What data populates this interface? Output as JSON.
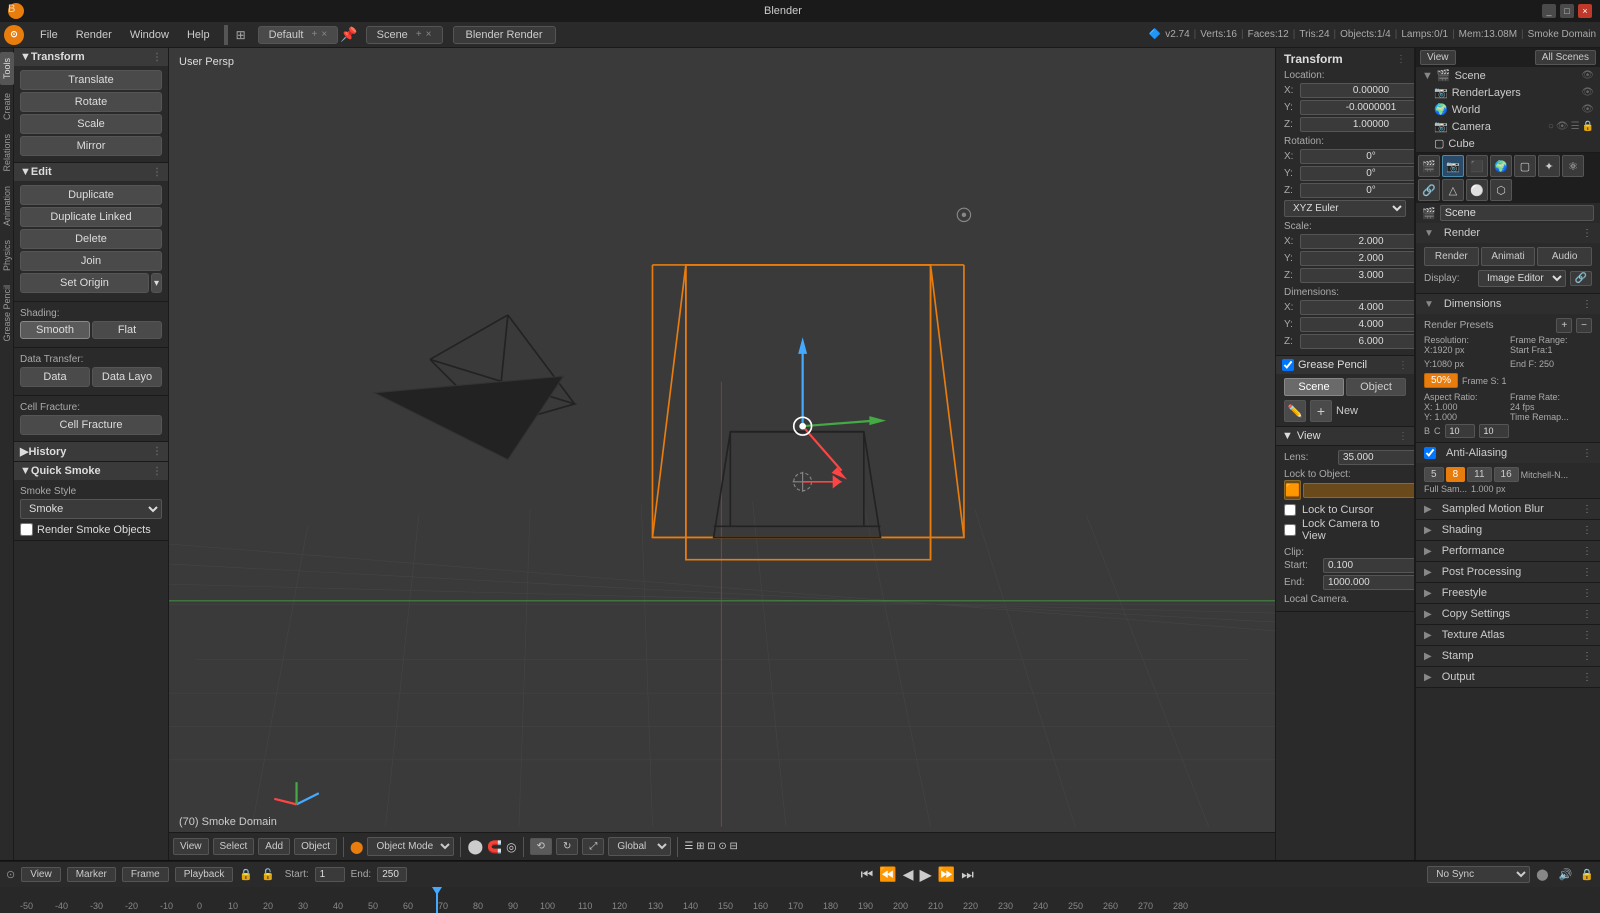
{
  "titlebar": {
    "title": "Blender",
    "icon": "B"
  },
  "menubar": {
    "items": [
      "File",
      "Render",
      "Window",
      "Help"
    ],
    "workspace": "Default",
    "scene": "Scene",
    "render_engine": "Blender Render"
  },
  "info": {
    "version": "v2.74",
    "verts": "Verts:16",
    "faces": "Faces:12",
    "tris": "Tris:24",
    "objects": "Objects:1/4",
    "lamps": "Lamps:0/1",
    "mem": "Mem:13.08M",
    "domain": "Smoke Domain"
  },
  "viewport": {
    "label": "User Persp",
    "smoke_label": "(70) Smoke Domain"
  },
  "left_panel": {
    "tabs": [
      "Tools",
      "Create",
      "Relations",
      "Animation",
      "Physics",
      "Grease Pencil"
    ],
    "transform": {
      "title": "Transform",
      "translate": "Translate",
      "rotate": "Rotate",
      "scale": "Scale",
      "mirror": "Mirror"
    },
    "edit": {
      "title": "Edit",
      "duplicate": "Duplicate",
      "duplicate_linked": "Duplicate Linked",
      "delete": "Delete",
      "join": "Join",
      "set_origin": "Set Origin"
    },
    "shading": {
      "title": "Shading:",
      "smooth": "Smooth",
      "flat": "Flat"
    },
    "data_transfer": {
      "title": "Data Transfer:",
      "data": "Data",
      "data_layo": "Data Layo"
    },
    "cell_fracture": {
      "title": "Cell Fracture:",
      "btn": "Cell Fracture"
    },
    "history": {
      "title": "History"
    },
    "quick_smoke": {
      "title": "Quick Smoke",
      "smoke_style_label": "Smoke Style",
      "smoke_style_value": "Smoke",
      "render_smoke_objects": "Render Smoke Objects"
    }
  },
  "right_transform": {
    "title": "Transform",
    "location": {
      "label": "Location:",
      "x": "0.00000",
      "y": "-0.0000001",
      "z": "1.00000"
    },
    "rotation": {
      "label": "Rotation:",
      "x": "0°",
      "y": "0°",
      "z": "0°",
      "mode": "XYZ Euler"
    },
    "scale": {
      "label": "Scale:",
      "x": "2.000",
      "y": "2.000",
      "z": "3.000"
    },
    "dimensions": {
      "label": "Dimensions:",
      "x": "4.000",
      "y": "4.000",
      "z": "6.000"
    }
  },
  "grease_pencil": {
    "title": "Grease Pencil",
    "scene_tab": "Scene",
    "object_tab": "Object",
    "new_btn": "New"
  },
  "view_panel": {
    "title": "View",
    "lens_label": "Lens:",
    "lens_value": "35.000",
    "lock_to_object": "Lock to Object:",
    "lock_obj_value": "",
    "lock_to_cursor": "Lock to Cursor",
    "lock_camera": "Lock Camera to View",
    "clip_label": "Clip:",
    "clip_start_label": "Start:",
    "clip_start": "0.100",
    "clip_end_label": "End:",
    "clip_end": "1000.000",
    "local_camera": "Local Camera."
  },
  "outliner": {
    "view_btn": "View",
    "search_btn": "All Scenes",
    "items": [
      {
        "name": "Scene",
        "icon": "🎬",
        "level": 0,
        "type": "scene"
      },
      {
        "name": "RenderLayers",
        "icon": "📷",
        "level": 1,
        "type": "renderlayer"
      },
      {
        "name": "World",
        "icon": "🌍",
        "level": 1,
        "type": "world"
      },
      {
        "name": "Camera",
        "icon": "📷",
        "level": 1,
        "type": "camera"
      },
      {
        "name": "Cube",
        "icon": "▢",
        "level": 1,
        "type": "mesh"
      }
    ]
  },
  "properties": {
    "icons": [
      "scene",
      "render",
      "layers",
      "world",
      "object",
      "particles",
      "physics",
      "constraints",
      "data",
      "materials",
      "texture"
    ],
    "render": {
      "title": "Render",
      "render_btn": "Render",
      "animation_btn": "Animati",
      "audio_btn": "Audio",
      "display_label": "Display:",
      "display_value": "Image Editor"
    },
    "dimensions": {
      "title": "Dimensions",
      "render_presets": "Render Presets",
      "resolution_label": "Resolution:",
      "x_res": "X:1920 px",
      "y_res": "Y:1080 px",
      "percent": "50%",
      "frame_range_label": "Frame Range:",
      "start_frame": "Start Fra:1",
      "end_frame": "End F: 250",
      "frame_step": "Frame S: 1",
      "aspect_label": "Aspect Ratio:",
      "aspect_x": "X: 1.000",
      "aspect_y": "Y: 1.000",
      "frame_rate_label": "Frame Rate:",
      "frame_rate": "24 fps",
      "time_remap": "Time Remap...",
      "b_label": "B",
      "c_label": "C",
      "b_value": "10",
      "c_value": "10"
    },
    "anti_aliasing": {
      "title": "Anti-Aliasing",
      "samples": [
        "5",
        "8",
        "11",
        "16"
      ],
      "active_sample": "8",
      "full_sample": "Full Sam...",
      "full_sample_value": "1.000 px",
      "filter": "Mitchell-N..."
    },
    "sampled_motion_blur": "Sampled Motion Blur",
    "shading": "Shading",
    "performance": "Performance",
    "post_processing": "Post Processing",
    "freestyle": "Freestyle",
    "copy_settings": "Copy Settings",
    "texture_atlas": "Texture Atlas",
    "stamp": "Stamp",
    "output": "Output"
  },
  "bottom_toolbar": {
    "view_btn": "View",
    "select_btn": "Select",
    "add_btn": "Add",
    "object_btn": "Object",
    "mode": "Object Mode",
    "pivot": "●",
    "transform": "Global",
    "start_label": "Start:",
    "start_val": "1",
    "end_label": "End:",
    "end_val": "250",
    "current": "70",
    "no_sync": "No Sync"
  },
  "timeline_markers": [
    "-50",
    "-40",
    "-30",
    "-20",
    "-10",
    "0",
    "10",
    "20",
    "30",
    "40",
    "50",
    "60",
    "70",
    "80",
    "90",
    "100",
    "110",
    "120",
    "130",
    "140",
    "150",
    "160",
    "170",
    "180",
    "190",
    "200",
    "210",
    "220",
    "230",
    "240",
    "250",
    "260",
    "270",
    "280"
  ]
}
